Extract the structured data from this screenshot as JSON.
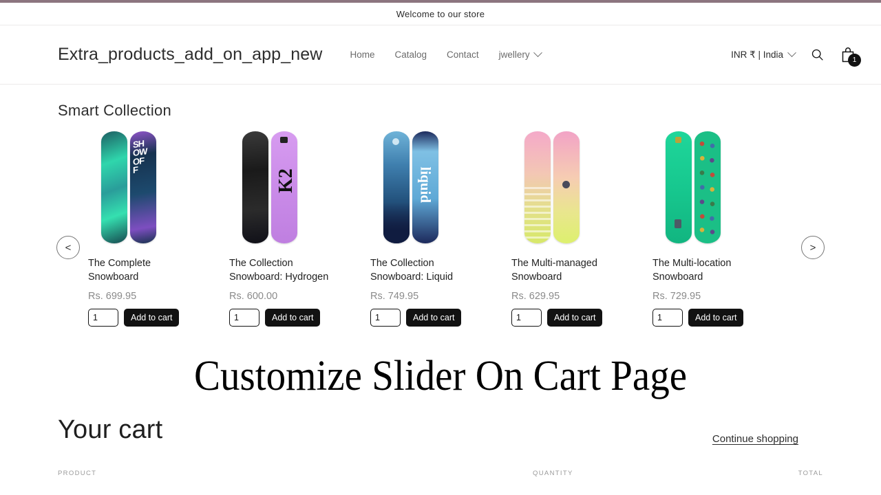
{
  "theme": {
    "accent_bar": "#8c757f",
    "button_bg": "#121212",
    "muted_text": "#8a8a8a"
  },
  "announcement": {
    "text": "Welcome to our store"
  },
  "header": {
    "brand": "Extra_products_add_on_app_new",
    "nav": [
      {
        "label": "Home",
        "caret": false
      },
      {
        "label": "Catalog",
        "caret": false
      },
      {
        "label": "Contact",
        "caret": false
      },
      {
        "label": "jwellery",
        "caret": true
      }
    ],
    "locale": "INR ₹ | India",
    "locale_caret_icon": "chevron-down-icon",
    "search_icon": "search-icon",
    "cart_icon": "shopping-bag-icon",
    "cart_count": "1"
  },
  "collection": {
    "title": "Smart Collection",
    "prev_label": "<",
    "next_label": ">",
    "products": [
      {
        "title": "The Complete Snowboard",
        "price": "Rs. 699.95",
        "qty": "1",
        "add_label": "Add to cart"
      },
      {
        "title": "The Collection Snowboard: Hydrogen",
        "price": "Rs. 600.00",
        "qty": "1",
        "add_label": "Add to cart"
      },
      {
        "title": "The Collection Snowboard: Liquid",
        "price": "Rs. 749.95",
        "qty": "1",
        "add_label": "Add to cart"
      },
      {
        "title": "The Multi-managed Snowboard",
        "price": "Rs. 629.95",
        "qty": "1",
        "add_label": "Add to cart"
      },
      {
        "title": "The Multi-location Snowboard",
        "price": "Rs. 729.95",
        "qty": "1",
        "add_label": "Add to cart"
      }
    ]
  },
  "banner": {
    "text": "Customize Slider On Cart Page"
  },
  "cart": {
    "title": "Your cart",
    "continue_label": "Continue shopping",
    "columns": {
      "product": "PRODUCT",
      "quantity": "QUANTITY",
      "total": "TOTAL"
    }
  }
}
